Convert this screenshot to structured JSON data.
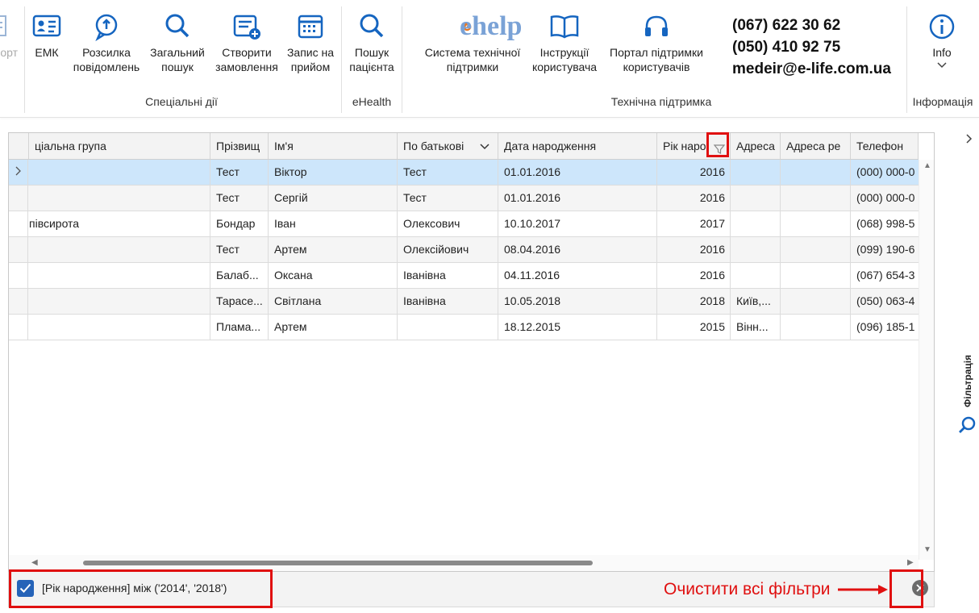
{
  "ribbon": {
    "partial_left_label": "орт",
    "special_actions": {
      "group_label": "Спеціальні дії",
      "buttons": [
        {
          "label": "ЕМК",
          "icon": "id-card-icon"
        },
        {
          "label": "Розсилка\nповідомлень",
          "icon": "message-bubble-icon"
        },
        {
          "label": "Загальний\nпошук",
          "icon": "search-icon"
        },
        {
          "label": "Створити\nзамовлення",
          "icon": "create-order-icon"
        },
        {
          "label": "Запис на\nприйом",
          "icon": "calendar-icon"
        }
      ]
    },
    "ehealth": {
      "group_label": "eHealth",
      "buttons": [
        {
          "label": "Пошук\nпацієнта",
          "icon": "search-icon"
        }
      ]
    },
    "support": {
      "group_label": "Технічна підтримка",
      "logo_text": "ehelp",
      "buttons": [
        {
          "label": "Система технічної\nпідтримки",
          "icon": "ehelp-logo-icon"
        },
        {
          "label": "Інструкції\nкористувача",
          "icon": "book-icon"
        },
        {
          "label": "Портал підтримки\nкористувачів",
          "icon": "headset-icon"
        }
      ],
      "contact": {
        "phone1": "(067) 622 30 62",
        "phone2": "(050) 410 92 75",
        "email": "medeir@e-life.com.ua"
      }
    },
    "info": {
      "group_label": "Інформація",
      "button_label": "Info",
      "icon": "info-icon"
    }
  },
  "grid": {
    "columns": [
      {
        "label": "ціальна група"
      },
      {
        "label": "Прізвищ"
      },
      {
        "label": "Ім'я"
      },
      {
        "label": "По батькові"
      },
      {
        "label": "Дата народження"
      },
      {
        "label": "Рік наро"
      },
      {
        "label": "Адреса"
      },
      {
        "label": "Адреса ре"
      },
      {
        "label": "Телефон"
      }
    ],
    "rows": [
      {
        "group": "",
        "surname": "Тест",
        "name": "Віктор",
        "patronymic": "Тест",
        "dob": "01.01.2016",
        "year": "2016",
        "addr": "",
        "addr2": "",
        "phone": "(000) 000-0"
      },
      {
        "group": "",
        "surname": "Тест",
        "name": "Сергій",
        "patronymic": "Тест",
        "dob": "01.01.2016",
        "year": "2016",
        "addr": "",
        "addr2": "",
        "phone": "(000) 000-0"
      },
      {
        "group": "півсирота",
        "surname": "Бондар",
        "name": "Іван",
        "patronymic": "Олексович",
        "dob": "10.10.2017",
        "year": "2017",
        "addr": "",
        "addr2": "",
        "phone": "(068) 998-5"
      },
      {
        "group": "",
        "surname": "Тест",
        "name": "Артем",
        "patronymic": "Олексійович",
        "dob": "08.04.2016",
        "year": "2016",
        "addr": "",
        "addr2": "",
        "phone": "(099) 190-6"
      },
      {
        "group": "",
        "surname": "Балаб...",
        "name": "Оксана",
        "patronymic": "Іванівна",
        "dob": "04.11.2016",
        "year": "2016",
        "addr": "",
        "addr2": "",
        "phone": "(067) 654-3"
      },
      {
        "group": "",
        "surname": "Тарасе...",
        "name": "Світлана",
        "patronymic": "Іванівна",
        "dob": "10.05.2018",
        "year": "2018",
        "addr": "Київ,...",
        "addr2": "",
        "phone": "(050) 063-4"
      },
      {
        "group": "",
        "surname": "Плама...",
        "name": "Артем",
        "patronymic": "",
        "dob": "18.12.2015",
        "year": "2015",
        "addr": "Вінн...",
        "addr2": "",
        "phone": "(096) 185-1"
      }
    ],
    "selected_row_index": 0
  },
  "filter": {
    "checked": true,
    "expression": "[Рік народження] між ('2014', '2018')",
    "annotation": "Очистити всі фільтри"
  },
  "side_panel": {
    "label": "Фільтрація"
  },
  "colors": {
    "accent": "#1565c0",
    "selection": "#cde6fb",
    "annotation_red": "#e01010"
  }
}
